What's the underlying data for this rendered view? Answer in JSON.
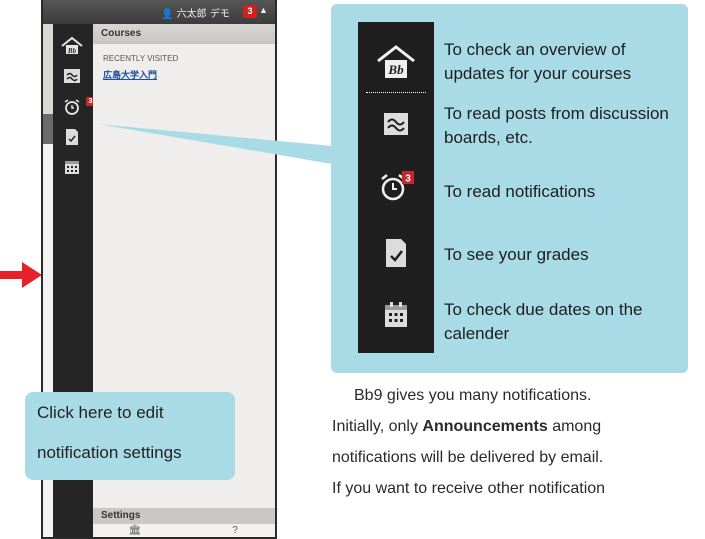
{
  "topbar": {
    "user_name": "六太郎 デモ",
    "notification_count": "3"
  },
  "rail": {
    "icons": [
      "blackboard-home-icon",
      "discussion-icon",
      "alarm-clock-icon",
      "grade-doc-icon",
      "calendar-icon"
    ],
    "badge": "3"
  },
  "menu": {
    "header": "Courses",
    "recent_label": "RECENTLY VISITED",
    "course_link": "広島大学入門",
    "settings_label": "Settings",
    "bottom_icons": [
      "institution-icon",
      "help-icon"
    ],
    "help_glyph": "?"
  },
  "callout": {
    "line1": "Click here to edit",
    "line2": "notification settings"
  },
  "legend": {
    "items": [
      {
        "icon": "blackboard-home-icon",
        "text": "To check an overview of updates for your courses"
      },
      {
        "icon": "discussion-icon",
        "text": "To read posts from discussion boards,  etc."
      },
      {
        "icon": "alarm-clock-icon",
        "text": "To read notifications",
        "badge": "3"
      },
      {
        "icon": "grade-doc-icon",
        "text": "To see your grades"
      },
      {
        "icon": "calendar-icon",
        "text": "To check due dates on the calender"
      }
    ]
  },
  "body": {
    "line1": "Bb9 gives you many notifications.",
    "line2_pre": "Initially, only ",
    "line2_bold": "Announcements",
    "line2_post": " among",
    "line3": "notifications will be delivered by email.",
    "line4": "If you want to receive other notification"
  },
  "colors": {
    "callout_bg": "#a8dbe6",
    "rail_bg": "#252525",
    "badge_red": "#c6262e",
    "arrow_red": "#e8202a",
    "link_blue": "#1d4d9a"
  }
}
